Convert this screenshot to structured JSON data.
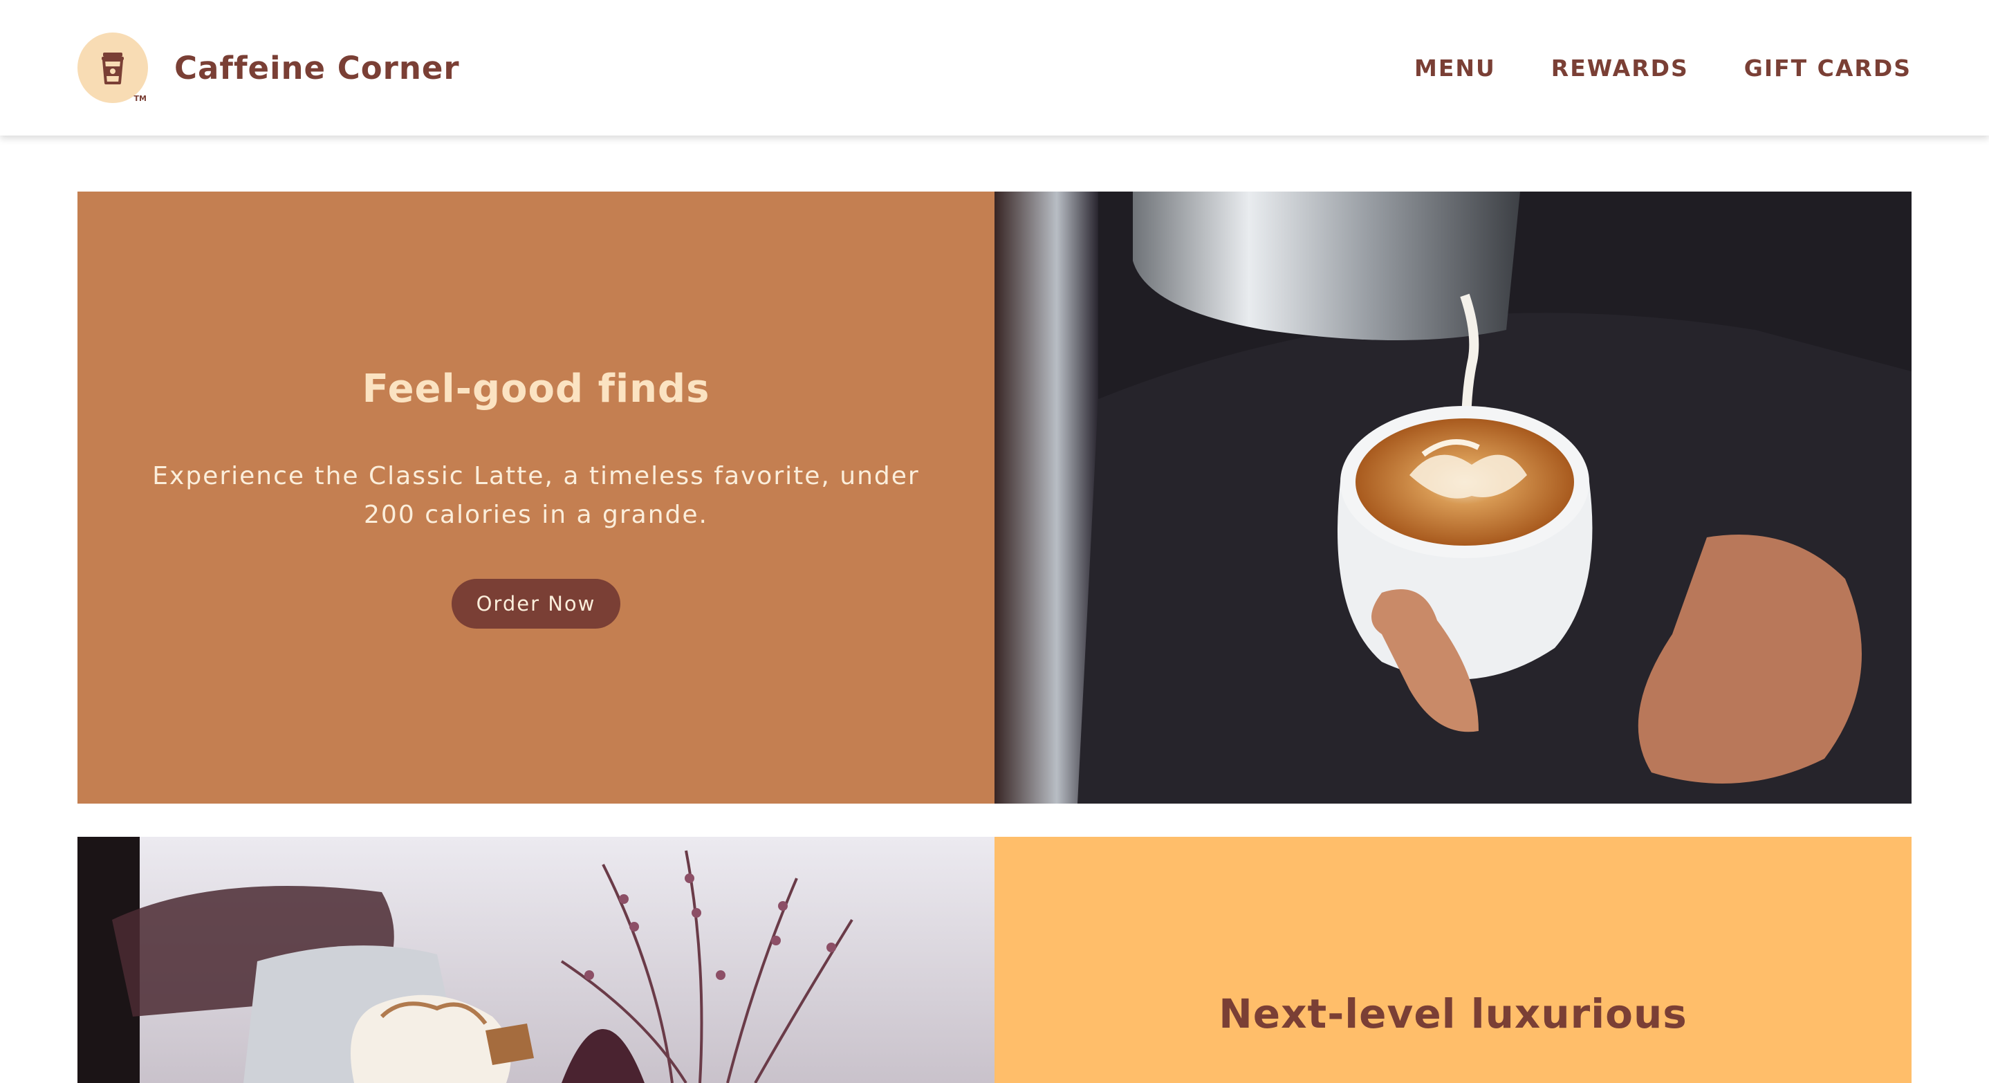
{
  "header": {
    "brand_name": "Caffeine Corner",
    "logo_mark": "TM",
    "logo_icon": "coffee-cup-icon",
    "nav": [
      {
        "label": "MENU"
      },
      {
        "label": "REWARDS"
      },
      {
        "label": "GIFT CARDS"
      }
    ]
  },
  "promo_latte": {
    "title": "Feel-good finds",
    "description": "Experience the Classic Latte, a timeless favorite, under 200 calories in a grande.",
    "button_label": "Order Now",
    "image": "latte-art-pour-photo"
  },
  "promo_luxurious": {
    "title": "Next-level luxurious",
    "image": "whipped-cream-drink-photo"
  },
  "colors": {
    "brand_brown": "#7a3f35",
    "promo_latte_bg": "#c47f51",
    "promo_luxurious_bg": "#ffbe6a",
    "logo_bg": "#f8dcb4",
    "title_cream": "#fbe3c2"
  }
}
